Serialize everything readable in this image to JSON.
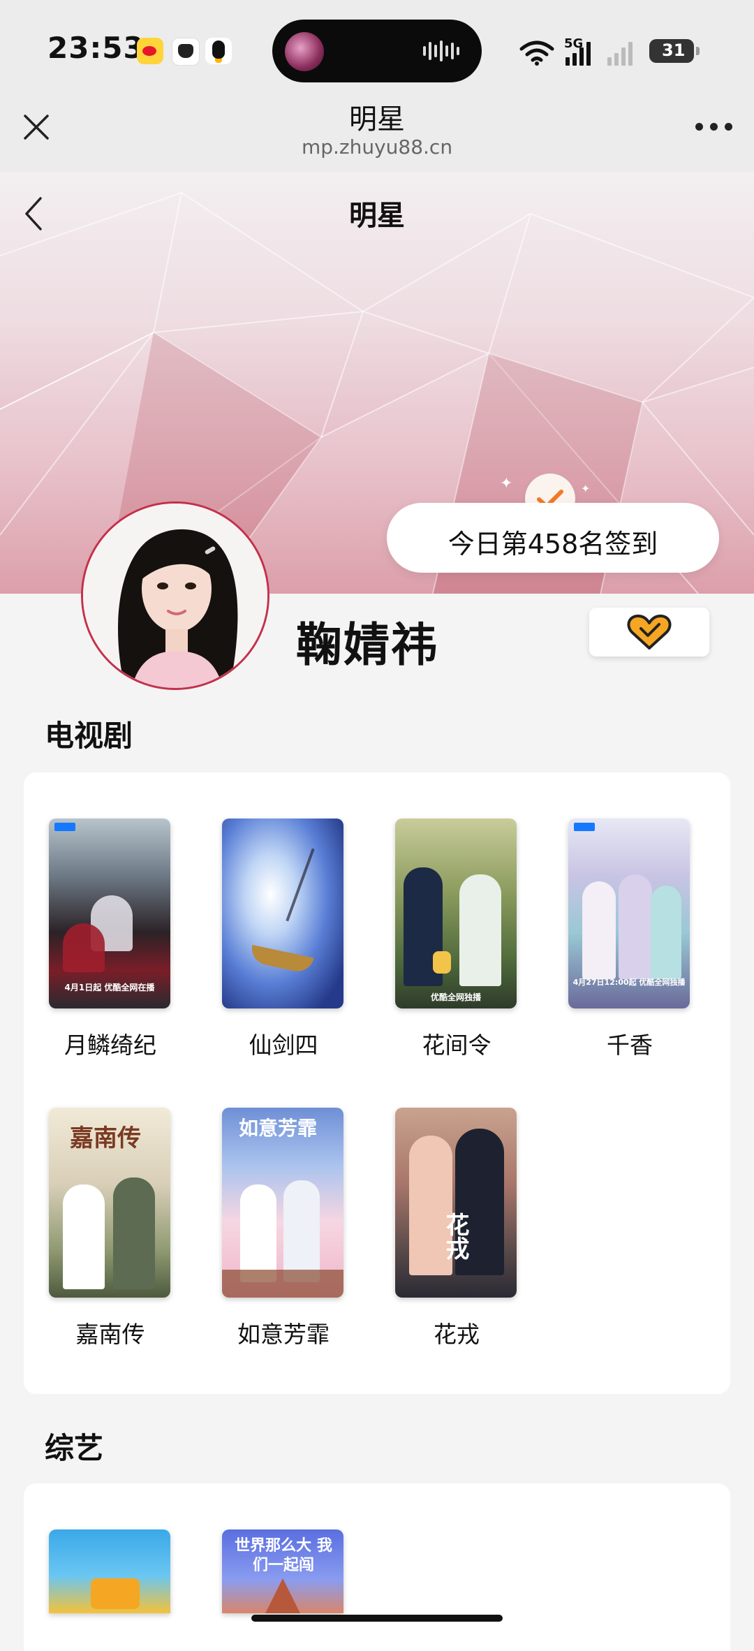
{
  "status_bar": {
    "time": "23:53",
    "network": "5G",
    "battery": "31"
  },
  "miniprogram": {
    "title": "明星",
    "url": "mp.zhuyu88.cn"
  },
  "page": {
    "title": "明星"
  },
  "checkin": {
    "text": "今日第458名签到"
  },
  "star": {
    "name": "鞠婧祎"
  },
  "sections": {
    "tv": {
      "title": "电视剧",
      "items": [
        {
          "title": "月鳞绮纪",
          "poster_caption": "4月1日起 优酷全网在播"
        },
        {
          "title": "仙剑四"
        },
        {
          "title": "花间令",
          "poster_caption": "优酷全网独播"
        },
        {
          "title": "千香",
          "poster_caption": "4月27日12:00起 优酷全网独播"
        },
        {
          "title": "嘉南传",
          "poster_art_text": "嘉南传"
        },
        {
          "title": "如意芳霏",
          "poster_art_text": "如意芳霏"
        },
        {
          "title": "花戎",
          "poster_art_text": "花戎"
        }
      ]
    },
    "variety": {
      "title": "综艺",
      "items": [
        {
          "poster_art_text": ""
        },
        {
          "poster_art_text": "世界那么大 我们一起闯"
        }
      ]
    }
  },
  "colors": {
    "accent": "#c4304a",
    "heart": "#f5a623",
    "check": "#f07a2a"
  }
}
